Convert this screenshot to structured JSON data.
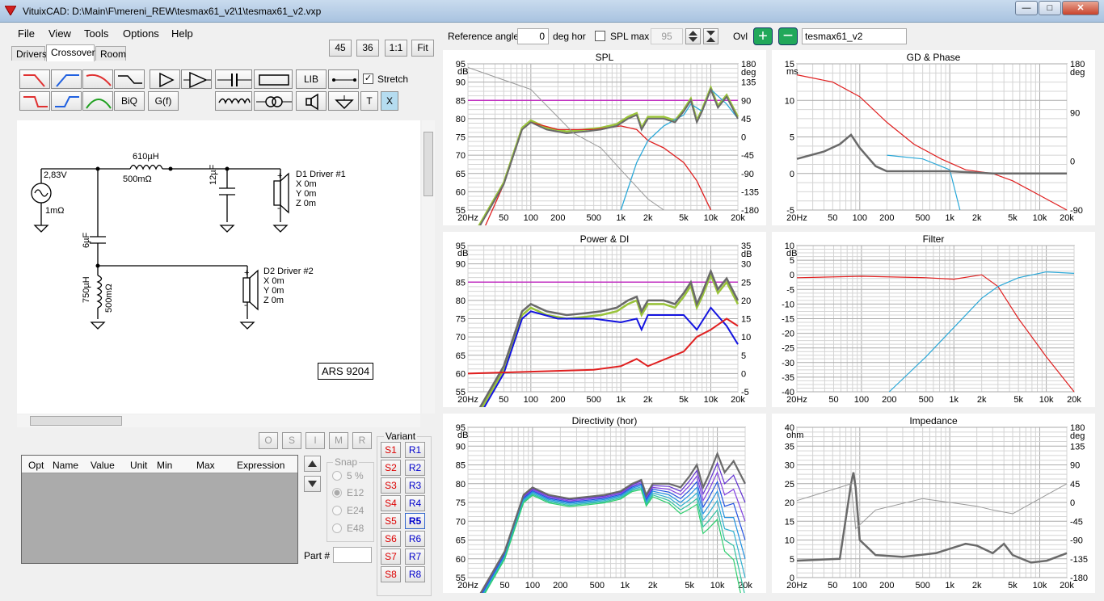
{
  "window": {
    "title": "VituixCAD: D:\\Main\\F\\mereni_REW\\tesmax61_v2\\1\\tesmax61_v2.vxp",
    "minimize": "—",
    "maximize": "□",
    "close": "✕"
  },
  "menu": [
    "File",
    "View",
    "Tools",
    "Options",
    "Help"
  ],
  "tabs": [
    "Drivers",
    "Crossover",
    "Room"
  ],
  "active_tab": "Crossover",
  "small_buttons": [
    "45",
    "36",
    "1:1",
    "Fit"
  ],
  "toolbar": {
    "row1": [
      "lowpass",
      "highpass",
      "bandpass",
      "shelf",
      "buffer",
      "opamp",
      "capacitor",
      "resistor",
      "LIB",
      "wire"
    ],
    "stretch": "Stretch",
    "row2": [
      "lowpass2",
      "highpass2",
      "bandpass2",
      "BiQ",
      "G(f)",
      "inductor",
      "transformer",
      "driver",
      "ground",
      "T",
      "X"
    ]
  },
  "schematic": {
    "source_voltage": "2,83V",
    "source_res": "1mΩ",
    "l1": "610µH",
    "l1_res": "500mΩ",
    "c1": "12µF",
    "c2": "6µF",
    "l2": "750µH",
    "l2_res": "500mΩ",
    "d1": {
      "name": "D1 Driver #1",
      "x": "X 0m",
      "y": "Y 0m",
      "z": "Z 0m"
    },
    "d2": {
      "name": "D2 Driver #2",
      "x": "X 0m",
      "y": "Y 0m",
      "z": "Z 0m"
    },
    "label": "ARS 9204"
  },
  "opt_buttons": [
    "O",
    "S",
    "I",
    "M",
    "R"
  ],
  "table_headers": [
    "Opt",
    "Name",
    "Value",
    "Unit",
    "Min",
    "Max",
    "Expression"
  ],
  "snap": {
    "title": "Snap",
    "options": [
      "5 %",
      "E12",
      "E24",
      "E48"
    ],
    "selected": "E12"
  },
  "part_label": "Part #",
  "variant": {
    "title": "Variant",
    "s": [
      "S1",
      "S2",
      "S3",
      "S4",
      "S5",
      "S6",
      "S7",
      "S8"
    ],
    "r": [
      "R1",
      "R2",
      "R3",
      "R4",
      "R5",
      "R6",
      "R7",
      "R8"
    ],
    "selected": "R5"
  },
  "top": {
    "ref_label": "Reference angle",
    "ref_value": "0",
    "ref_unit": "deg hor",
    "splmax_label": "SPL max",
    "splmax_value": "95",
    "ovl_label": "Ovl",
    "ovl_value": "tesmax61_v2"
  },
  "freq_ticks": [
    "20Hz",
    "50",
    "100",
    "200",
    "500",
    "1k",
    "2k",
    "5k",
    "10k",
    "20k"
  ],
  "charts": {
    "spl": {
      "title": "SPL",
      "left_unit": "dB",
      "right_unit": "deg",
      "left": [
        "95",
        "90",
        "85",
        "80",
        "75",
        "70",
        "65",
        "60",
        "55"
      ],
      "right": [
        "180",
        "135",
        "90",
        "45",
        "0",
        "-45",
        "-90",
        "-135",
        "-180"
      ]
    },
    "gd": {
      "title": "GD & Phase",
      "left_unit": "ms",
      "right_unit": "deg",
      "left": [
        "15",
        "10",
        "5",
        "0",
        "-5"
      ],
      "right": [
        "180",
        "90",
        "0",
        "-90"
      ]
    },
    "power": {
      "title": "Power & DI",
      "left_unit": "dB",
      "right_unit": "dB",
      "left": [
        "95",
        "90",
        "85",
        "80",
        "75",
        "70",
        "65",
        "60",
        "55"
      ],
      "right": [
        "35",
        "30",
        "25",
        "20",
        "15",
        "10",
        "5",
        "0",
        "-5"
      ]
    },
    "filter": {
      "title": "Filter",
      "left_unit": "dB",
      "left": [
        "10",
        "5",
        "0",
        "-5",
        "-10",
        "-15",
        "-20",
        "-25",
        "-30",
        "-35",
        "-40"
      ]
    },
    "dir": {
      "title": "Directivity (hor)",
      "left_unit": "dB",
      "left": [
        "95",
        "90",
        "85",
        "80",
        "75",
        "70",
        "65",
        "60",
        "55"
      ]
    },
    "imp": {
      "title": "Impedance",
      "left_unit": "ohm",
      "right_unit": "deg",
      "left": [
        "40",
        "35",
        "30",
        "25",
        "20",
        "15",
        "10",
        "5",
        "0"
      ],
      "right": [
        "180",
        "135",
        "90",
        "45",
        "0",
        "-45",
        "-90",
        "-135",
        "-180"
      ]
    }
  },
  "colors": {
    "red": "#e02020",
    "blue": "#1414e0",
    "cyan": "#2aa8d8",
    "green": "#9ac43a",
    "gray": "#6a6a6a",
    "magenta": "#c030c0"
  }
}
